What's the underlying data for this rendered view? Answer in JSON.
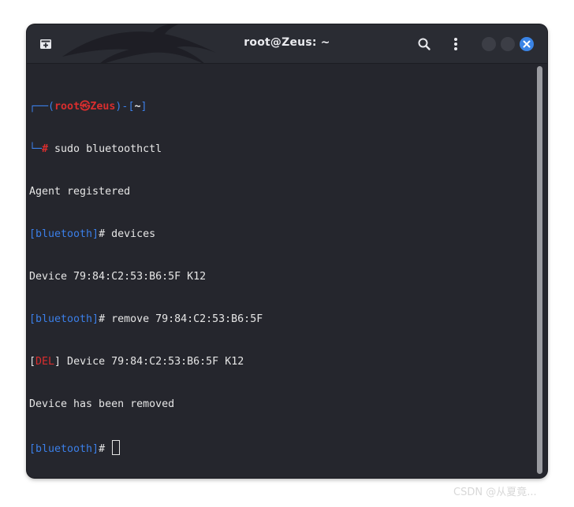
{
  "window": {
    "title": "root@Zeus: ~",
    "accent": "#3a84e6",
    "background": "#25262d"
  },
  "toolbar": {
    "new_tab_icon": "new-tab-icon",
    "search_icon": "search-icon",
    "menu_icon": "kebab-menu-icon",
    "close_icon": "close-icon"
  },
  "terminal": {
    "prompt": {
      "corner_top": "┌──",
      "open_paren": "(",
      "user": "root",
      "at_symbol": "㉿",
      "host": "Zeus",
      "close_paren": ")",
      "dash": "-",
      "dir_open": "[",
      "dir": "~",
      "dir_close": "]",
      "corner_bottom": "└─",
      "hash": "#",
      "command": " sudo bluetoothctl"
    },
    "lines": {
      "agent": "Agent registered",
      "bt_prompt_1": "[bluetooth]",
      "cmd_1": "# devices",
      "device_listing": "Device 79:84:C2:53:B6:5F K12",
      "bt_prompt_2": "[bluetooth]",
      "cmd_2": "# remove 79:84:C2:53:B6:5F",
      "del_open": "[",
      "del_tag": "DEL",
      "del_rest": "] Device 79:84:C2:53:B6:5F K12",
      "removed": "Device has been removed",
      "bt_prompt_3": "[bluetooth]",
      "cmd_3": "# "
    }
  },
  "watermark": "CSDN @从夏竟..."
}
